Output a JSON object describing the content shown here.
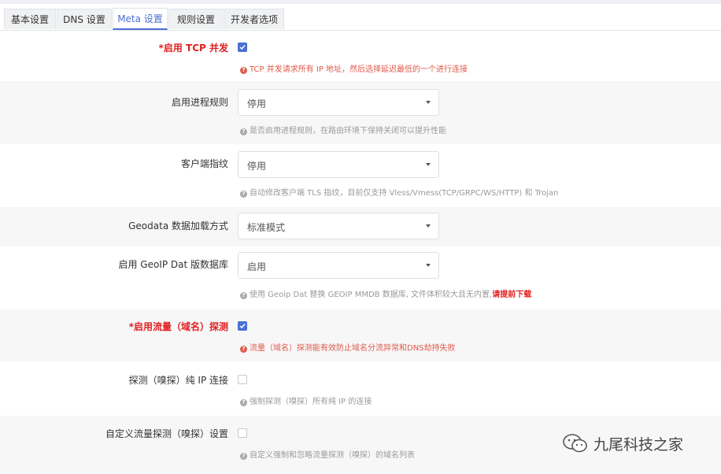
{
  "tabs": [
    {
      "label": "基本设置",
      "active": false
    },
    {
      "label": "DNS 设置",
      "active": false
    },
    {
      "label": "Meta 设置",
      "active": true
    },
    {
      "label": "规则设置",
      "active": false
    },
    {
      "label": "开发者选项",
      "active": false
    }
  ],
  "settings": {
    "tcp_concurrent": {
      "label": "*启用 TCP 并发",
      "checked": true,
      "help": "TCP 并发请求所有 IP 地址，然后选择延迟最低的一个进行连接"
    },
    "process_rules": {
      "label": "启用进程规则",
      "value": "停用",
      "help": "是否启用进程规则，在路由环境下保持关闭可以提升性能"
    },
    "client_fingerprint": {
      "label": "客户端指纹",
      "value": "停用",
      "help": "自动修改客户端 TLS 指纹，目前仅支持 Vless/Vmess(TCP/GRPC/WS/HTTP) 和 Trojan"
    },
    "geodata_loader": {
      "label": "Geodata 数据加载方式",
      "value": "标准模式"
    },
    "geoip_dat": {
      "label": "启用 GeoIP Dat 版数据库",
      "value": "启用",
      "help": "使用 Geoip Dat 替换 GEOIP MMDB 数据库, 文件体积较大且无内置,",
      "help_link": "请提前下载"
    },
    "sniffing": {
      "label": "*启用流量（域名）探测",
      "checked": true,
      "help": "流量（域名）探测能有效防止域名分流异常和DNS劫持失败"
    },
    "sniff_pure_ip": {
      "label": "探测（嗅探）纯 IP 连接",
      "checked": false,
      "help": "强制探测（嗅探）所有纯 IP 的连接"
    },
    "custom_sniffing": {
      "label": "自定义流量探测（嗅探）设置",
      "checked": false,
      "help": "自定义强制和忽略流量探测（嗅探）的域名列表"
    }
  },
  "icons": {
    "help": "question-circle-icon",
    "check": "check-icon",
    "caret": "caret-down-icon",
    "watermark_logo": "wechat-logo-icon"
  },
  "watermark": {
    "text": "九尾科技之家"
  },
  "colors": {
    "accent": "#4a6fd6",
    "required": "#e02020",
    "help_red": "#e05a4a",
    "alt_row": "#f7f7f8"
  }
}
